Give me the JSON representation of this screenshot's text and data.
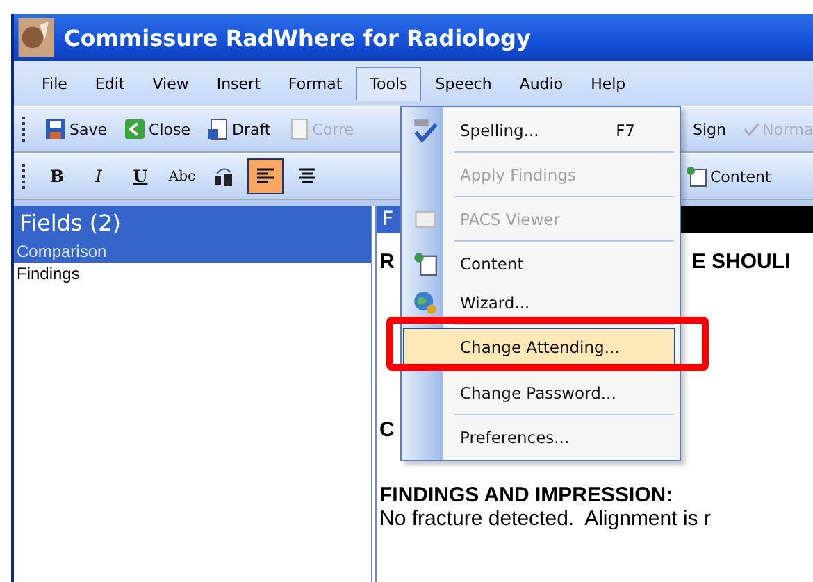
{
  "window": {
    "title": "Commissure RadWhere for Radiology"
  },
  "menu_bar": [
    {
      "label": "File",
      "selected": false
    },
    {
      "label": "Edit",
      "selected": false
    },
    {
      "label": "View",
      "selected": false
    },
    {
      "label": "Insert",
      "selected": false
    },
    {
      "label": "Format",
      "selected": false
    },
    {
      "label": "Tools",
      "selected": true
    },
    {
      "label": "Speech",
      "selected": false
    },
    {
      "label": "Audio",
      "selected": false
    },
    {
      "label": "Help",
      "selected": false
    }
  ],
  "toolbar": [
    {
      "label": "Save",
      "kind": "save",
      "disabled": false
    },
    {
      "label": "Close",
      "kind": "close",
      "disabled": false
    },
    {
      "label": "Draft",
      "kind": "draft",
      "disabled": false
    },
    {
      "label": "Corre",
      "kind": "correct",
      "disabled": true
    },
    {
      "label": "Sign",
      "kind": "sign",
      "disabled": false
    },
    {
      "label": "Norma",
      "kind": "normal",
      "disabled": true
    }
  ],
  "format_toolbar": [
    {
      "label": "B",
      "kind": "bold",
      "selected": false
    },
    {
      "label": "I",
      "kind": "italic",
      "selected": false
    },
    {
      "label": "U",
      "kind": "underline",
      "selected": false
    },
    {
      "label": "Abc",
      "kind": "abc",
      "selected": false
    },
    {
      "kind": "case",
      "selected": false
    },
    {
      "kind": "align-left",
      "selected": true
    },
    {
      "kind": "align-center",
      "selected": false
    },
    {
      "label": "Content",
      "kind": "content",
      "selected": false
    }
  ],
  "fields_panel": {
    "title": "Fields (2)",
    "items": [
      {
        "label": "Comparison",
        "selected": true
      },
      {
        "label": "Findings",
        "selected": false
      }
    ]
  },
  "report": {
    "header": "F",
    "lines": [
      {
        "text": "R",
        "tail": "E SHOULI",
        "bold": true
      },
      {
        "text": "C",
        "bold": true
      },
      {
        "text": "FINDINGS AND IMPRESSION:",
        "bold": true
      },
      {
        "text": "No fracture detected.  Alignment is r",
        "bold": false
      }
    ]
  },
  "tools_menu": [
    {
      "label": "Spelling...",
      "shortcut": "F7",
      "kind": "spelling",
      "disabled": false,
      "highlighted": false
    },
    {
      "kind": "separator"
    },
    {
      "label": "Apply Findings",
      "kind": "plain",
      "disabled": true,
      "highlighted": false
    },
    {
      "kind": "separator"
    },
    {
      "label": "PACS Viewer",
      "kind": "pacs",
      "disabled": true,
      "highlighted": false
    },
    {
      "kind": "separator"
    },
    {
      "label": "Content",
      "kind": "content",
      "disabled": false,
      "highlighted": false
    },
    {
      "label": "Wizard...",
      "kind": "wizard",
      "disabled": false,
      "highlighted": false
    },
    {
      "kind": "separator"
    },
    {
      "label": "Change Attending...",
      "kind": "plain",
      "disabled": false,
      "highlighted": true
    },
    {
      "label": "Change Password...",
      "kind": "plain",
      "disabled": false,
      "highlighted": false
    },
    {
      "kind": "separator"
    },
    {
      "label": "Preferences...",
      "kind": "plain",
      "disabled": false,
      "highlighted": false
    }
  ]
}
